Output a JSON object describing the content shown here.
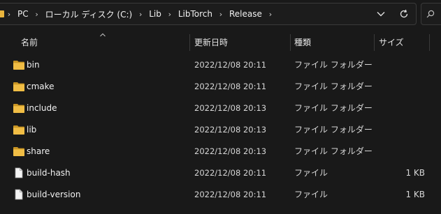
{
  "address": {
    "breadcrumbs": [
      "PC",
      "ローカル ディスク (C:)",
      "Lib",
      "LibTorch",
      "Release"
    ],
    "dropdown_icon": "chevron-down-icon",
    "refresh_icon": "refresh-icon"
  },
  "columns": {
    "name": "名前",
    "date": "更新日時",
    "type": "種類",
    "size": "サイズ"
  },
  "files": [
    {
      "name": "bin",
      "date": "2022/12/08 20:11",
      "type": "ファイル フォルダー",
      "size": "",
      "icon": "folder-icon"
    },
    {
      "name": "cmake",
      "date": "2022/12/08 20:11",
      "type": "ファイル フォルダー",
      "size": "",
      "icon": "folder-icon"
    },
    {
      "name": "include",
      "date": "2022/12/08 20:13",
      "type": "ファイル フォルダー",
      "size": "",
      "icon": "folder-icon"
    },
    {
      "name": "lib",
      "date": "2022/12/08 20:13",
      "type": "ファイル フォルダー",
      "size": "",
      "icon": "folder-icon"
    },
    {
      "name": "share",
      "date": "2022/12/08 20:13",
      "type": "ファイル フォルダー",
      "size": "",
      "icon": "folder-icon"
    },
    {
      "name": "build-hash",
      "date": "2022/12/08 20:11",
      "type": "ファイル",
      "size": "1 KB",
      "icon": "file-icon"
    },
    {
      "name": "build-version",
      "date": "2022/12/08 20:11",
      "type": "ファイル",
      "size": "1 KB",
      "icon": "file-icon"
    }
  ],
  "colors": {
    "background": "#191919",
    "folder": "#e8b43d",
    "text": "#f0f0f0"
  }
}
